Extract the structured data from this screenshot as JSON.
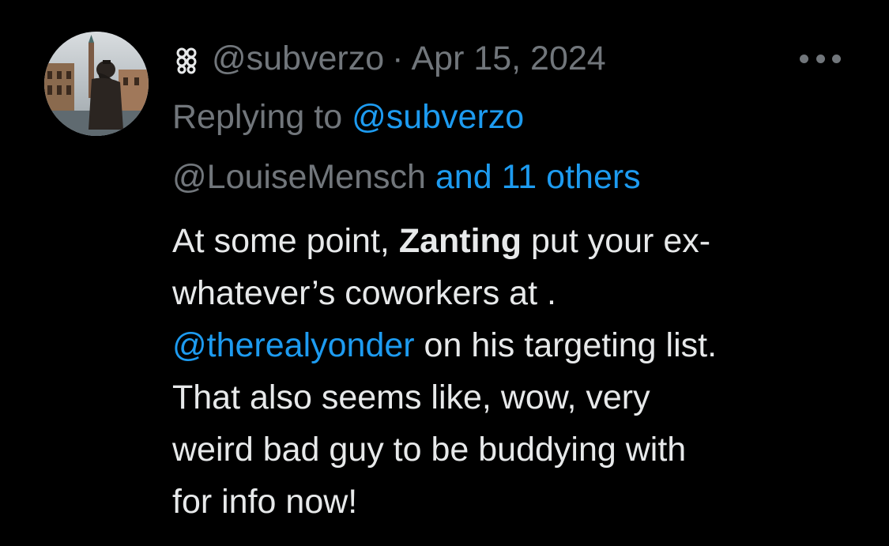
{
  "author": {
    "handle": "@subverzo",
    "emoji_icon": "flower-emoji-icon"
  },
  "meta": {
    "separator": "·",
    "date": "Apr 15, 2024"
  },
  "more_icon": "ellipsis-icon",
  "reply": {
    "prefix": "Replying to ",
    "user1": "@subverzo",
    "user2": "@LouiseMensch",
    "others": "and 11 others"
  },
  "body": {
    "l1a": "At some point, ",
    "l1b": "Zanting",
    "l1c": " put your ex-",
    "l2": "whatever’s coworkers at .",
    "l3_mention": "@therealyonder",
    "l3_rest": " on his targeting list.",
    "l4": "That also seems like, wow, very",
    "l5": "weird bad guy to be buddying with",
    "l6": "for info now!"
  },
  "colors": {
    "background": "#000000",
    "text": "#e7e9ea",
    "secondary": "#71767b",
    "link": "#1d9bf0"
  }
}
